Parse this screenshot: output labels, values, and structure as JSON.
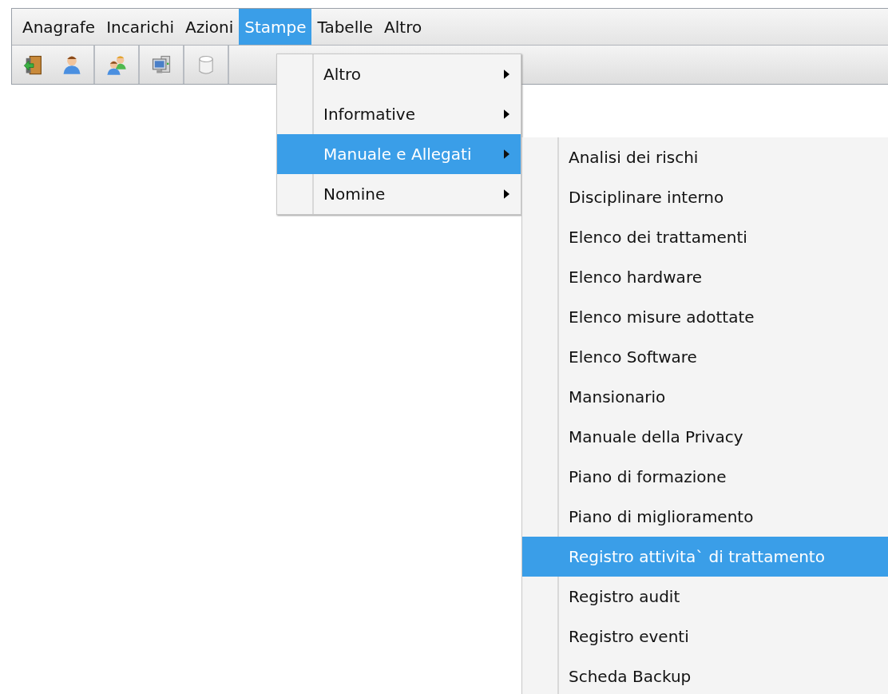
{
  "menubar": [
    {
      "label": "Anagrafe",
      "selected": false
    },
    {
      "label": "Incarichi",
      "selected": false
    },
    {
      "label": "Azioni",
      "selected": false
    },
    {
      "label": "Stampe",
      "selected": true
    },
    {
      "label": "Tabelle",
      "selected": false
    },
    {
      "label": "Altro",
      "selected": false
    }
  ],
  "toolbar": [
    {
      "kind": "exit"
    },
    {
      "kind": "user"
    },
    {
      "kind": "users"
    },
    {
      "kind": "computer"
    },
    {
      "kind": "database"
    }
  ],
  "menu": [
    {
      "label": "Altro",
      "selected": false
    },
    {
      "label": "Informative",
      "selected": false
    },
    {
      "label": "Manuale e Allegati",
      "selected": true
    },
    {
      "label": "Nomine",
      "selected": false
    }
  ],
  "submenu": [
    {
      "label": "Analisi dei rischi",
      "selected": false
    },
    {
      "label": "Disciplinare interno",
      "selected": false
    },
    {
      "label": "Elenco dei trattamenti",
      "selected": false
    },
    {
      "label": "Elenco hardware",
      "selected": false
    },
    {
      "label": "Elenco misure adottate",
      "selected": false
    },
    {
      "label": "Elenco Software",
      "selected": false
    },
    {
      "label": "Mansionario",
      "selected": false
    },
    {
      "label": "Manuale della Privacy",
      "selected": false
    },
    {
      "label": "Piano di formazione",
      "selected": false
    },
    {
      "label": "Piano di miglioramento",
      "selected": false
    },
    {
      "label": "Registro attivita` di trattamento",
      "selected": true
    },
    {
      "label": "Registro audit",
      "selected": false
    },
    {
      "label": "Registro eventi",
      "selected": false
    },
    {
      "label": "Scheda Backup",
      "selected": false
    }
  ]
}
